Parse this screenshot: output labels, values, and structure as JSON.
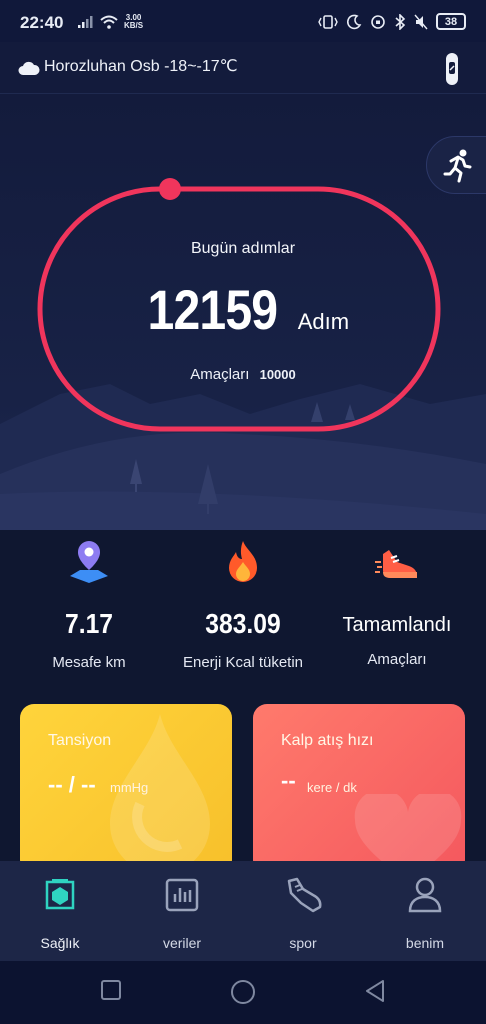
{
  "status_bar": {
    "time": "22:40",
    "speed_value": "3.00",
    "speed_unit": "KB/S",
    "battery": "38"
  },
  "header": {
    "weather_icon": "cloud-icon",
    "weather_text": "Horozluhan Osb -18~-17℃",
    "device_icon": "band-icon"
  },
  "steps": {
    "title": "Bugün adımlar",
    "count": "12159",
    "unit": "Adım",
    "goal_label": "Amaçları",
    "goal_value": "10000",
    "progress": 1.0,
    "ring_color": "#f0355c"
  },
  "stats": [
    {
      "icon": "location-pin-icon",
      "value": "7.17",
      "label": "Mesafe km"
    },
    {
      "icon": "flame-icon",
      "value": "383.09",
      "label": "Enerji Kcal tüketin"
    },
    {
      "icon": "running-shoe-icon",
      "value": "Tamamlandı",
      "label": "Amaçları"
    }
  ],
  "cards": {
    "blood_pressure": {
      "title": "Tansiyon",
      "value": "-- / --",
      "unit": "mmHg",
      "color": "#ffd43b"
    },
    "heart_rate": {
      "title": "Kalp atış hızı",
      "value": "--",
      "unit": "kere / dk",
      "color": "#f4585e"
    }
  },
  "nav": [
    {
      "label": "Sağlık",
      "icon": "health-icon",
      "active": true
    },
    {
      "label": "veriler",
      "icon": "chart-icon",
      "active": false
    },
    {
      "label": "spor",
      "icon": "sneaker-icon",
      "active": false
    },
    {
      "label": "benim",
      "icon": "person-icon",
      "active": false
    }
  ],
  "colors": {
    "accent": "#2fd3c1",
    "background": "#0f1730"
  }
}
